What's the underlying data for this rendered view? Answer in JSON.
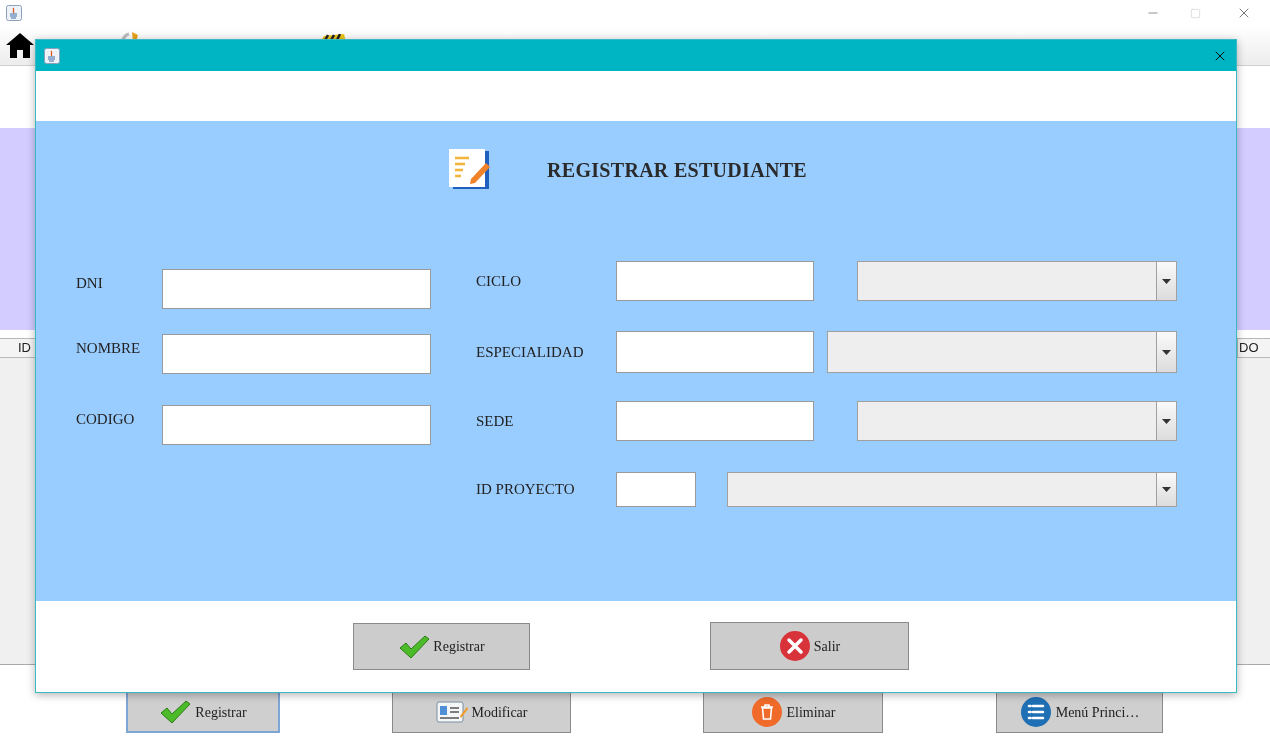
{
  "main_window": {
    "table": {
      "columns": [
        "ID",
        "DO"
      ]
    },
    "buttons": [
      {
        "label": "Registrar",
        "kind": "check",
        "focused": true
      },
      {
        "label": "Modificar",
        "kind": "card",
        "focused": false
      },
      {
        "label": "Eliminar",
        "kind": "trash",
        "focused": false
      },
      {
        "label": "Menú Princi…",
        "kind": "list",
        "focused": false
      }
    ]
  },
  "dialog": {
    "heading": "REGISTRAR ESTUDIANTE",
    "left_fields": [
      {
        "label": "DNI"
      },
      {
        "label": "NOMBRE"
      },
      {
        "label": "CODIGO"
      }
    ],
    "right_fields": [
      {
        "label": "CICLO",
        "combo_disabled": true
      },
      {
        "label": "ESPECIALIDAD",
        "combo_disabled": true
      },
      {
        "label": "SEDE",
        "combo_disabled": true
      },
      {
        "label": "ID PROYECTO",
        "combo_disabled": true
      }
    ],
    "buttons": [
      {
        "label": "Registrar",
        "kind": "check"
      },
      {
        "label": "Salir",
        "kind": "cancel"
      }
    ]
  }
}
